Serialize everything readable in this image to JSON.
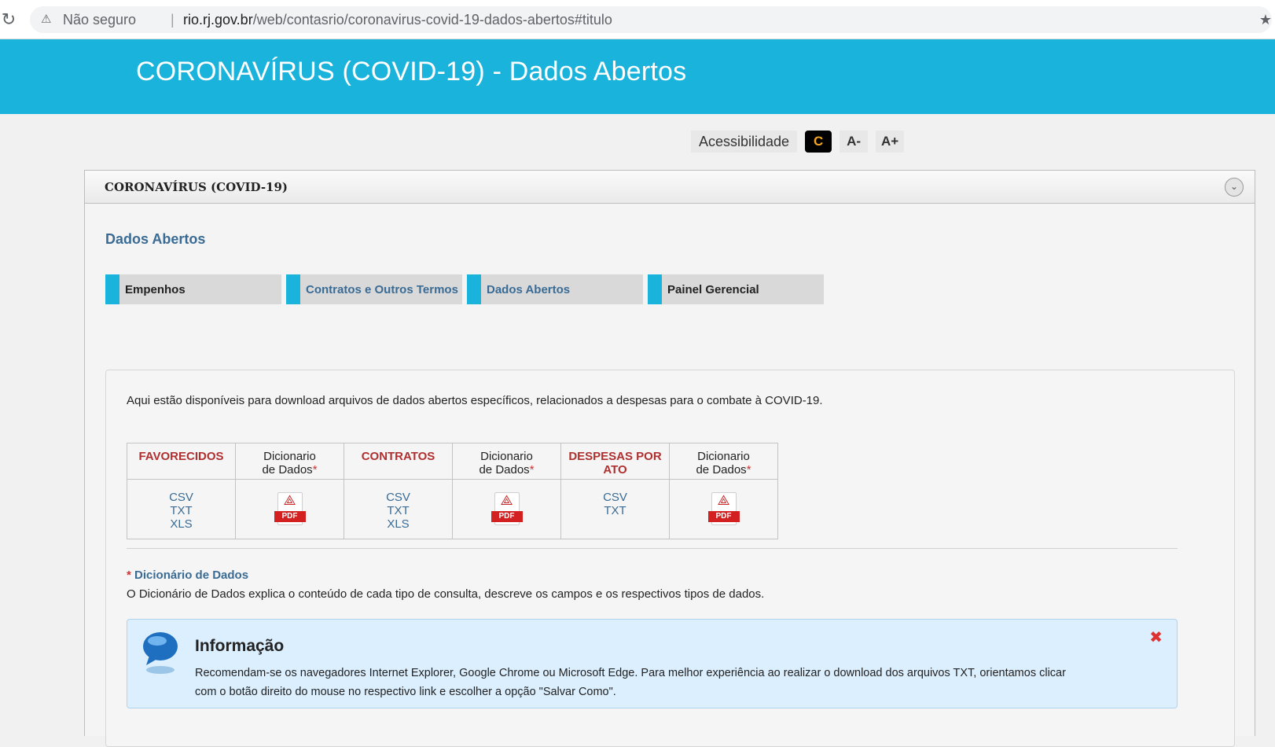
{
  "browser": {
    "reload_icon": "reload-icon",
    "warning": "⚠",
    "insecure_label": "Não seguro",
    "separator": "|",
    "url_host": "rio.rj.gov.br",
    "url_path": "/web/contasrio/coronavirus-covid-19-dados-abertos#titulo"
  },
  "banner": {
    "title": "CORONAVÍRUS (COVID-19) - Dados Abertos"
  },
  "accessibility": {
    "label": "Acessibilidade",
    "contrast": "C",
    "decrease": "A-",
    "increase": "A+"
  },
  "portlet": {
    "title": "CORONAVÍRUS (COVID-19)",
    "section_title": "Dados Abertos",
    "tabs": [
      {
        "label": "Empenhos"
      },
      {
        "label": "Contratos e Outros Termos"
      },
      {
        "label": "Dados Abertos"
      },
      {
        "label": "Painel Gerencial"
      }
    ]
  },
  "content": {
    "intro": "Aqui estão disponíveis para download arquivos de dados abertos específicos, relacionados a despesas para o combate à COVID-19.",
    "table": {
      "columns": [
        {
          "type": "category",
          "label": "FAVORECIDOS",
          "formats": [
            "CSV",
            "TXT",
            "XLS"
          ]
        },
        {
          "type": "dictionary",
          "label_line1": "Dicionario",
          "label_line2": "de Dados",
          "asterisk": "*",
          "pdf_label": "PDF"
        },
        {
          "type": "category",
          "label": "CONTRATOS",
          "formats": [
            "CSV",
            "TXT",
            "XLS"
          ]
        },
        {
          "type": "dictionary",
          "label_line1": "Dicionario",
          "label_line2": "de Dados",
          "asterisk": "*",
          "pdf_label": "PDF"
        },
        {
          "type": "category",
          "label_line1": "DESPESAS POR",
          "label_line2": "ATO",
          "formats": [
            "CSV",
            "TXT"
          ]
        },
        {
          "type": "dictionary",
          "label_line1": "Dicionario",
          "label_line2": "de Dados",
          "asterisk": "*",
          "pdf_label": "PDF"
        }
      ]
    },
    "dictionary_note": {
      "asterisk": "*",
      "title": "Dicionário de Dados",
      "description": "O Dicionário de Dados explica o conteúdo de cada tipo de consulta, descreve os campos e os respectivos tipos de dados."
    },
    "info_box": {
      "title": "Informação",
      "text": "Recomendam-se os navegadores Internet Explorer, Google Chrome ou Microsoft Edge. Para melhor experiência ao realizar o download dos arquivos TXT, orientamos clicar com o botão direito do mouse no respectivo link e escolher a opção \"Salvar Como\".",
      "close": "✖"
    }
  },
  "colors": {
    "banner": "#1ab3db",
    "category_red": "#b03030",
    "link_blue": "#3a6b94",
    "info_bg": "#dcefff"
  }
}
